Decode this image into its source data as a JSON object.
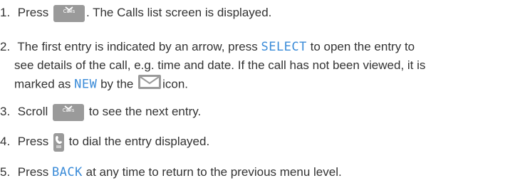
{
  "steps": [
    {
      "num": "1.",
      "a": "Press",
      "b": ". The Calls list screen is displayed."
    },
    {
      "num": "2.",
      "a": "The first entry is indicated by an arrow, press",
      "lcd1": "SELECT",
      "b": "to open the entry to",
      "line2": "see details of the call, e.g. time and date. If the call has not been viewed, it is",
      "c": "marked as",
      "lcd2": "NEW",
      "d": "by the",
      "e": "icon."
    },
    {
      "num": "3.",
      "a": "Scroll",
      "b": "to see the next entry."
    },
    {
      "num": "4.",
      "a": "Press",
      "b": "to dial the entry displayed."
    },
    {
      "num": "5.",
      "a": "Press",
      "lcd1": "BACK",
      "b": "at any time to return to the previous menu level."
    }
  ],
  "icons": {
    "calls_key": "calls-key-icon",
    "calls_label": "Calls",
    "talk_key": "talk-key-icon",
    "envelope": "envelope-icon"
  },
  "colors": {
    "text": "#333333",
    "lcd": "#3a8bd8",
    "key": "#9a9a9a"
  }
}
